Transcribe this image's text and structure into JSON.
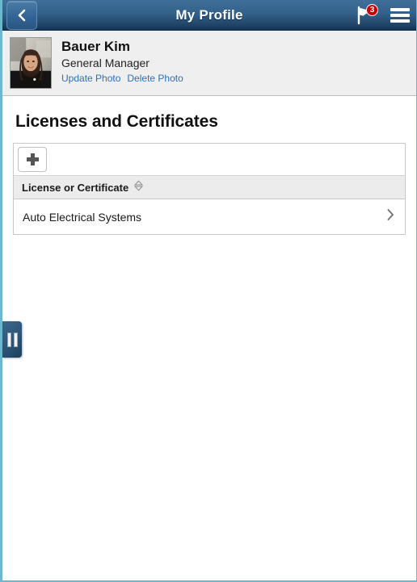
{
  "header": {
    "title": "My Profile",
    "back_icon": "chevron-left-icon",
    "notifications_icon": "flag-icon",
    "notifications_count": "3",
    "menu_icon": "hamburger-menu-icon"
  },
  "profile": {
    "avatar_alt": "employee-photo",
    "name": "Bauer Kim",
    "role": "General Manager",
    "update_photo_label": "Update Photo",
    "delete_photo_label": "Delete Photo"
  },
  "main": {
    "section_title": "Licenses and Certificates",
    "add_button_icon": "plus-icon",
    "table": {
      "columns": [
        {
          "label": "License or Certificate",
          "sort_icon": "sort-diamond-icon"
        }
      ],
      "rows": [
        {
          "name": "Auto Electrical Systems",
          "chevron_icon": "chevron-right-icon"
        }
      ]
    }
  },
  "side_tab": {
    "icon": "pause-handle-icon"
  },
  "colors": {
    "header_top": "#3f6e98",
    "header_bottom": "#143355",
    "badge": "#cc0000",
    "link": "#2f6fbd",
    "panel_bg": "#efefef",
    "grid_header_bg": "#ececec",
    "frame_edge": "#6cb8ce"
  }
}
